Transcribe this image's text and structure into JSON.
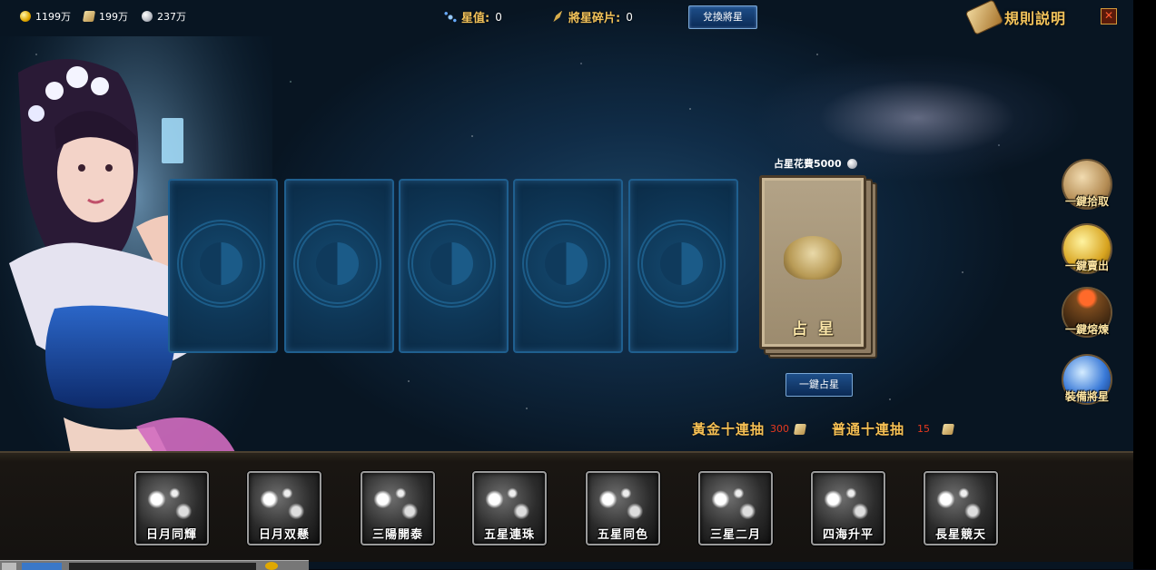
{
  "topbar": {
    "gold": "1199万",
    "scroll": "199万",
    "silver": "237万",
    "star_value_label": "星值:",
    "star_value": "0",
    "fragment_label": "將星碎片:",
    "fragment_value": "0",
    "exchange_button": "兌換將星",
    "rules_label": "規則説明",
    "close_label": "✕"
  },
  "deck": {
    "cost_label": "占星花費5000",
    "title": "占星",
    "divine_button": "一鍵占星"
  },
  "side_buttons": [
    {
      "label": "一鍵拾取",
      "icon": "scroll-bag-icon"
    },
    {
      "label": "一鍵賣出",
      "icon": "gold-coin-icon"
    },
    {
      "label": "一鍵熔煉",
      "icon": "furnace-icon"
    },
    {
      "label": "裝備將星",
      "icon": "crystal-ball-icon"
    }
  ],
  "draw": {
    "gold_ten_label": "黃金十連抽",
    "gold_ten_cost": "300",
    "normal_ten_label": "普通十連抽",
    "normal_ten_cost": "15"
  },
  "constellations": [
    "日月同輝",
    "日月双懸",
    "三陽開泰",
    "五星連珠",
    "五星同色",
    "三星二月",
    "四海升平",
    "長星競天"
  ],
  "colors": {
    "accent_gold": "#f6c054",
    "cost_red": "#e7391f",
    "button_blue": "#0b2a55"
  }
}
